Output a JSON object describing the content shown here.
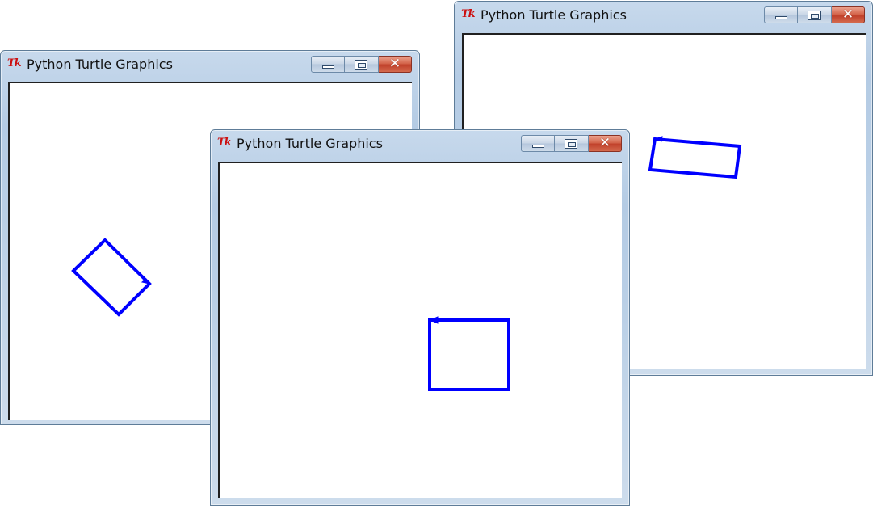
{
  "windows": [
    {
      "title": "Python Turtle Graphics",
      "icon": "tk-feather-icon",
      "icon_text": "Tk",
      "shape": "diamond",
      "stroke": "#0000ff"
    },
    {
      "title": "Python Turtle Graphics",
      "icon": "tk-feather-icon",
      "icon_text": "Tk",
      "shape": "tilted-rectangle",
      "stroke": "#0000ff"
    },
    {
      "title": "Python Turtle Graphics",
      "icon": "tk-feather-icon",
      "icon_text": "Tk",
      "shape": "square",
      "stroke": "#0000ff"
    }
  ],
  "controls": {
    "minimize": "minimize-icon",
    "maximize": "maximize-icon",
    "close": "close-icon",
    "close_glyph": "✕"
  },
  "colors": {
    "turtle_stroke": "#0000ff",
    "close_button": "#c7442c",
    "frame": "#b9cfe6"
  }
}
